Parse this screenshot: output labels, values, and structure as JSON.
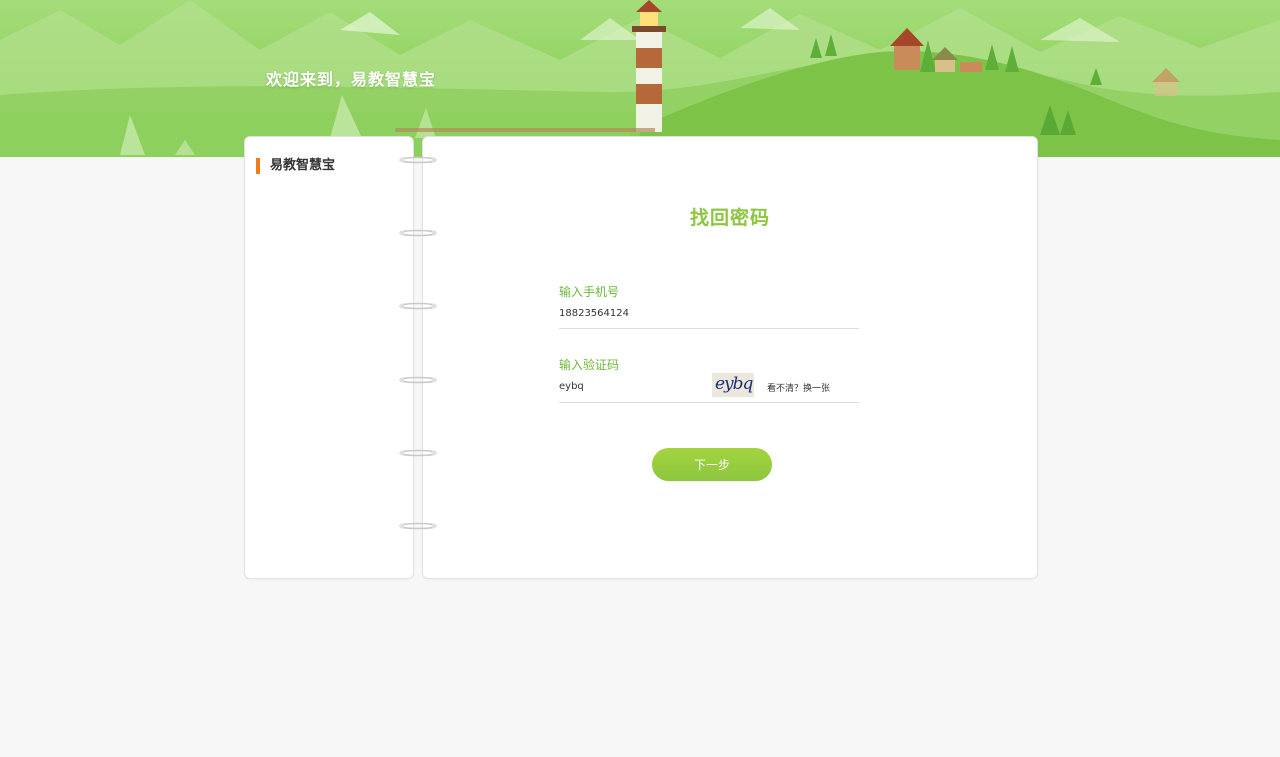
{
  "header": {
    "welcome_text": "欢迎来到，易教智慧宝"
  },
  "sidebar": {
    "title": "易教智慧宝"
  },
  "form": {
    "title": "找回密码",
    "phone_label": "输入手机号",
    "phone_value": "18823564124",
    "code_label": "输入验证码",
    "code_value": "eybq",
    "captcha_text": "eybq",
    "refresh_text": "看不清？换一张",
    "next_button": "下一步"
  },
  "colors": {
    "brand_green": "#8cc63f",
    "accent_orange": "#f07a1e",
    "label_green": "#6cb93a"
  }
}
